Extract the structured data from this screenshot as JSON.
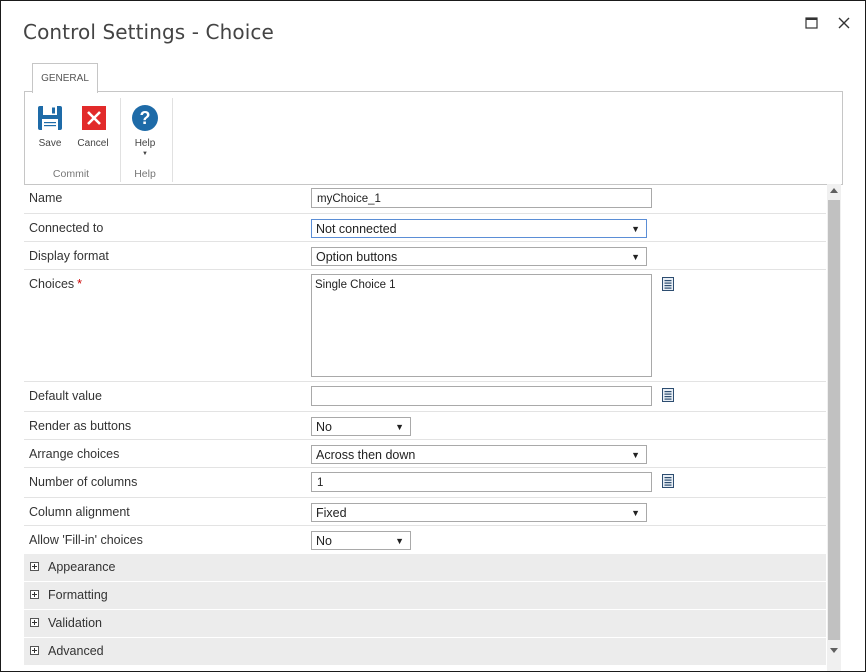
{
  "window": {
    "title": "Control Settings - Choice",
    "maximize_icon": "maximize-icon",
    "close_icon": "close-icon"
  },
  "ribbon": {
    "tab": "GENERAL",
    "buttons": {
      "save": "Save",
      "cancel": "Cancel",
      "help": "Help"
    },
    "groups": {
      "commit": "Commit",
      "help": "Help"
    },
    "colors": {
      "save": "#1e6ba8",
      "cancel": "#e22a2a",
      "help": "#1e6ba8"
    }
  },
  "form": {
    "name": {
      "label": "Name",
      "value": "myChoice_1"
    },
    "connected_to": {
      "label": "Connected to",
      "value": "Not connected"
    },
    "display_format": {
      "label": "Display format",
      "value": "Option buttons"
    },
    "choices": {
      "label": "Choices",
      "required": "*",
      "value": "Single Choice 1"
    },
    "default_value": {
      "label": "Default value",
      "value": ""
    },
    "render_as_buttons": {
      "label": "Render as buttons",
      "value": "No"
    },
    "arrange_choices": {
      "label": "Arrange choices",
      "value": "Across then down"
    },
    "number_of_columns": {
      "label": "Number of columns",
      "value": "1"
    },
    "column_alignment": {
      "label": "Column alignment",
      "value": "Fixed"
    },
    "allow_fillin": {
      "label": "Allow 'Fill-in' choices",
      "value": "No"
    }
  },
  "sections": [
    "Appearance",
    "Formatting",
    "Validation",
    "Advanced"
  ],
  "dropdown_arrow": "▼"
}
